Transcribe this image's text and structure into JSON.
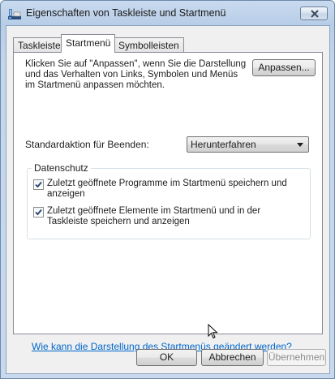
{
  "window": {
    "title": "Eigenschaften von Taskleiste und Startmenü",
    "close_icon": "close-icon",
    "app_icon": "taskbar-properties-icon"
  },
  "tabs": [
    {
      "label": "Taskleiste",
      "active": false
    },
    {
      "label": "Startmenü",
      "active": true
    },
    {
      "label": "Symbolleisten",
      "active": false
    }
  ],
  "startmenu": {
    "description": "Klicken Sie auf \"Anpassen\", wenn Sie die Darstellung und das Verhalten von Links, Symbolen und Menüs im Startmenü anpassen möchten.",
    "customize_button": "Anpassen...",
    "power_action_label": "Standardaktion für Beenden:",
    "power_action_value": "Herunterfahren",
    "privacy_group": "Datenschutz",
    "checkboxes": [
      {
        "label": "Zuletzt geöffnete Programme im Startmenü speichern und anzeigen",
        "checked": true
      },
      {
        "label": "Zuletzt geöffnete Elemente im Startmenü und in der Taskleiste speichern und anzeigen",
        "checked": true
      }
    ],
    "help_link": "Wie kann die Darstellung des Startmenüs geändert werden?"
  },
  "buttons": {
    "ok": "OK",
    "cancel": "Abbrechen",
    "apply": "Übernehmen"
  },
  "colors": {
    "accent_link": "#0066cc",
    "frame": "#c4d6ec"
  }
}
